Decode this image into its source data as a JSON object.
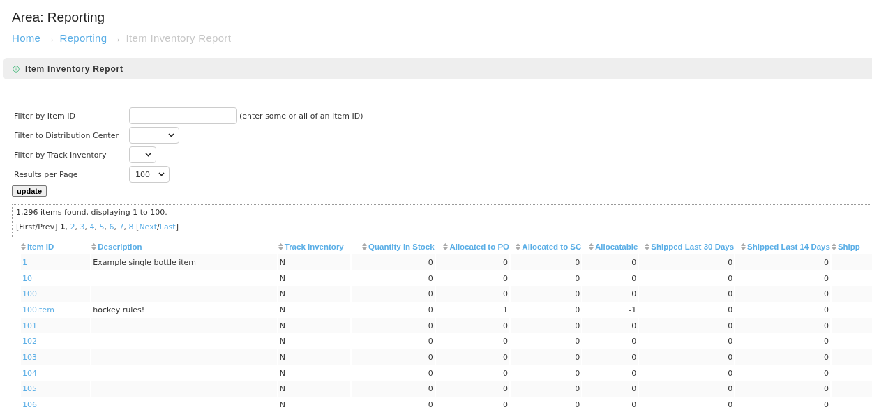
{
  "area_title": "Area: Reporting",
  "breadcrumb": {
    "separator": "→",
    "items": [
      {
        "label": "Home",
        "kind": "link"
      },
      {
        "label": "Reporting",
        "kind": "link"
      },
      {
        "label": "Item Inventory Report",
        "kind": "current"
      }
    ]
  },
  "panel": {
    "title": "Item Inventory Report"
  },
  "filters": [
    {
      "label": "Filter by Item ID",
      "kind": "text",
      "hint": "(enter some or all of an Item ID)"
    },
    {
      "label": "Filter to Distribution Center",
      "kind": "select"
    },
    {
      "label": "Filter by Track Inventory",
      "kind": "select"
    },
    {
      "label": "Results per Page",
      "kind": "select",
      "value": "100"
    }
  ],
  "update_button": "update",
  "summary": "1,296 items found, displaying 1 to 100.",
  "pagination": {
    "open": "[",
    "close": "]",
    "slash": "/",
    "comma": ",",
    "first_prev": "First/Prev",
    "next": "Next",
    "last": "Last",
    "pages": [
      {
        "label": "1",
        "selected": true
      },
      {
        "label": "2",
        "selected": false
      },
      {
        "label": "3",
        "selected": false
      },
      {
        "label": "4",
        "selected": false
      },
      {
        "label": "5",
        "selected": false
      },
      {
        "label": "6",
        "selected": false
      },
      {
        "label": "7",
        "selected": false
      },
      {
        "label": "8",
        "selected": false
      }
    ]
  },
  "table": {
    "columns": [
      {
        "label": "Item ID",
        "kind": "link"
      },
      {
        "label": "Description",
        "kind": "text"
      },
      {
        "label": "Track Inventory",
        "kind": "text"
      },
      {
        "label": "Quantity in Stock",
        "kind": "number"
      },
      {
        "label": "Allocated to PO",
        "kind": "number"
      },
      {
        "label": "Allocated to SC",
        "kind": "number"
      },
      {
        "label": "Allocatable",
        "kind": "number"
      },
      {
        "label": "Shipped Last 30 Days",
        "kind": "number"
      },
      {
        "label": "Shipped Last 14 Days",
        "kind": "number"
      },
      {
        "label": "Shipp",
        "kind": "text"
      }
    ],
    "rows": [
      [
        "1",
        "Example single bottle item",
        "N",
        "0",
        "0",
        "0",
        "0",
        "0",
        "0"
      ],
      [
        "10",
        "",
        "N",
        "0",
        "0",
        "0",
        "0",
        "0",
        "0"
      ],
      [
        "100",
        "",
        "N",
        "0",
        "0",
        "0",
        "0",
        "0",
        "0"
      ],
      [
        "100item",
        "hockey rules!",
        "N",
        "0",
        "1",
        "0",
        "-1",
        "0",
        "0"
      ],
      [
        "101",
        "",
        "N",
        "0",
        "0",
        "0",
        "0",
        "0",
        "0"
      ],
      [
        "102",
        "",
        "N",
        "0",
        "0",
        "0",
        "0",
        "0",
        "0"
      ],
      [
        "103",
        "",
        "N",
        "0",
        "0",
        "0",
        "0",
        "0",
        "0"
      ],
      [
        "104",
        "",
        "N",
        "0",
        "0",
        "0",
        "0",
        "0",
        "0"
      ],
      [
        "105",
        "",
        "N",
        "0",
        "0",
        "0",
        "0",
        "0",
        "0"
      ],
      [
        "106",
        "",
        "N",
        "0",
        "0",
        "0",
        "0",
        "0",
        "0"
      ]
    ]
  }
}
